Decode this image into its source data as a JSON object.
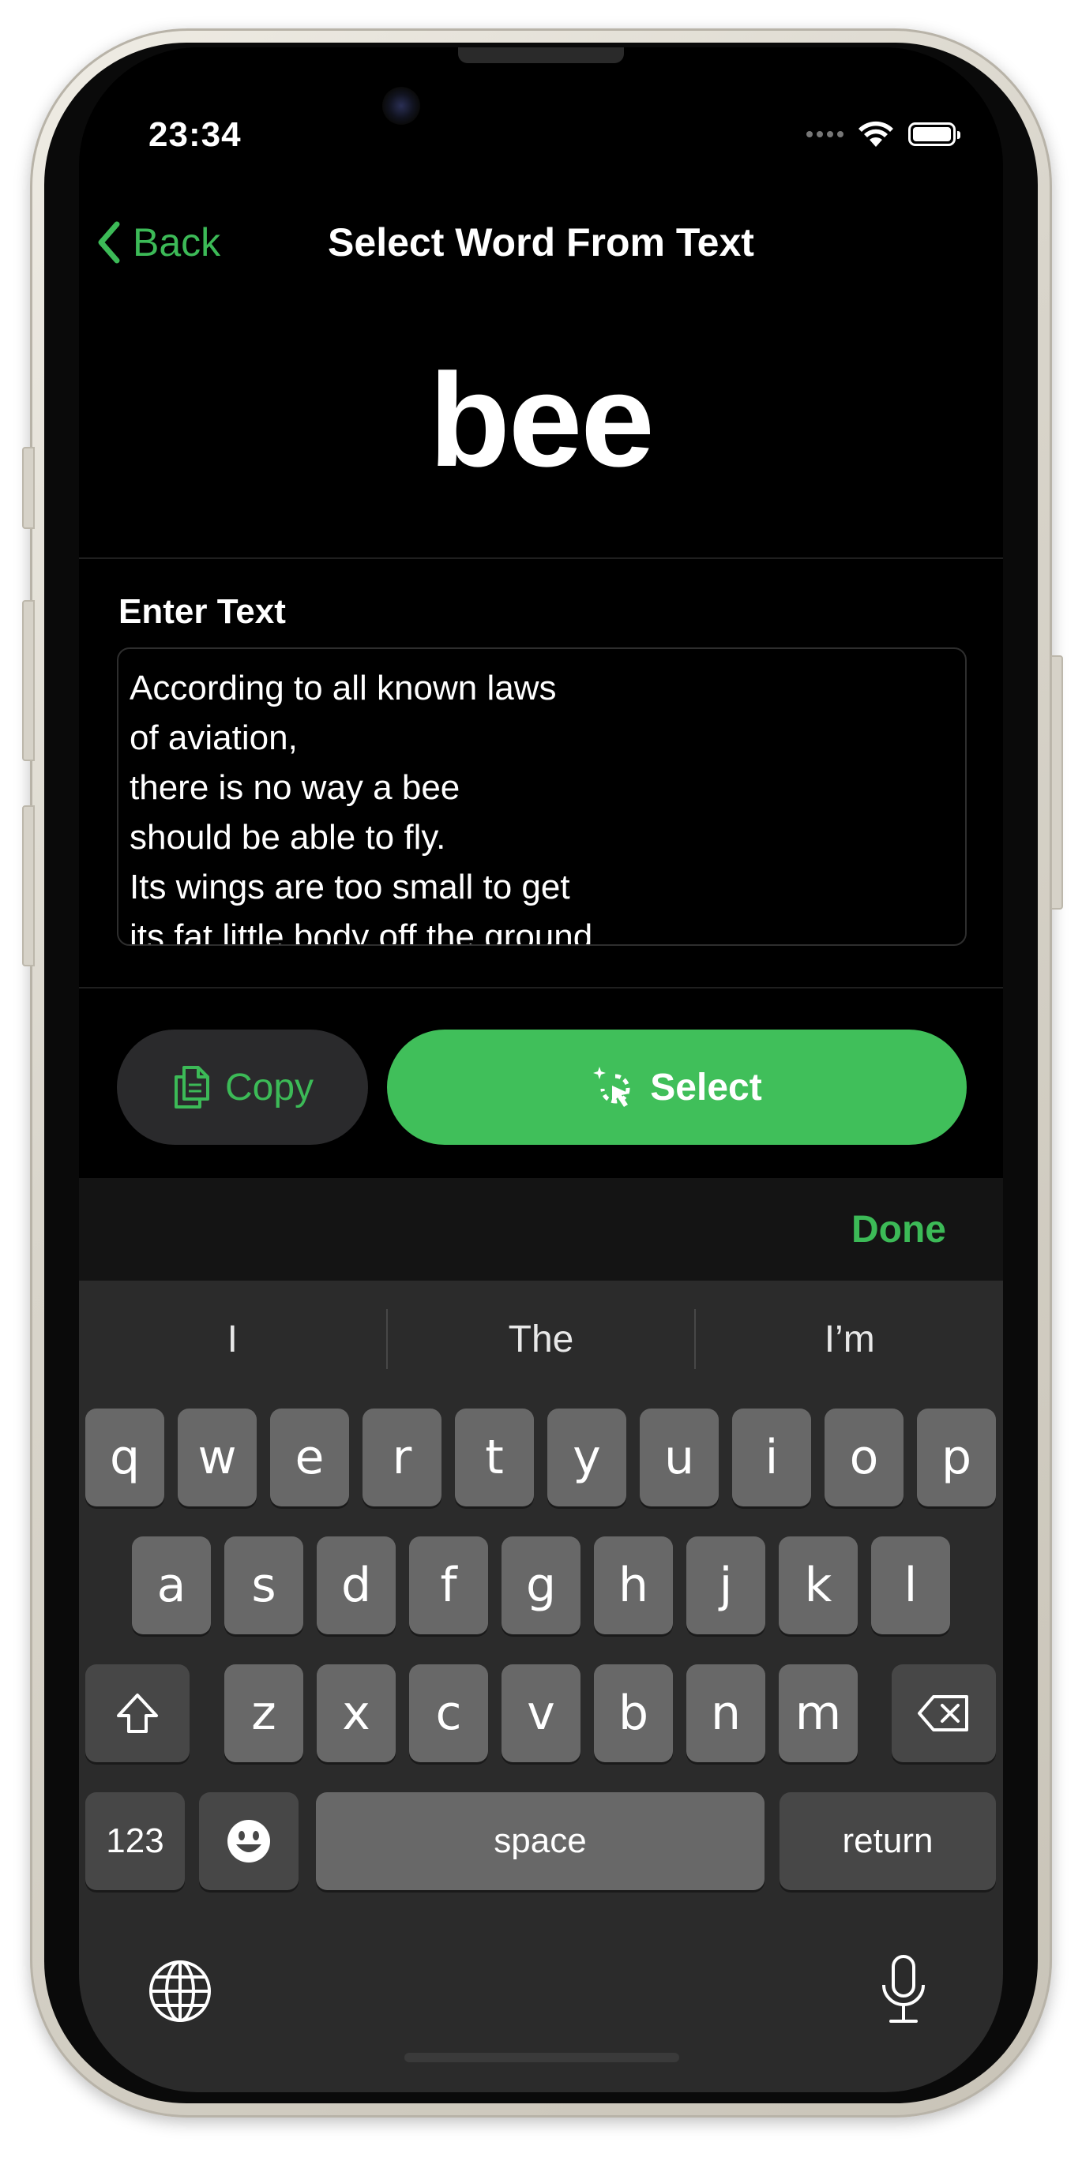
{
  "status_bar": {
    "time": "23:34"
  },
  "nav": {
    "back_label": "Back",
    "title": "Select Word From Text"
  },
  "selected_word": "bee",
  "input_section": {
    "label": "Enter Text",
    "lines": [
      "According to all known laws",
      "of aviation,",
      "there is no way a bee",
      "should be able to fly.",
      "Its wings are too small to get",
      "its fat little body off the ground."
    ]
  },
  "actions": {
    "copy_label": "Copy",
    "select_label": "Select"
  },
  "accessory": {
    "done_label": "Done"
  },
  "keyboard": {
    "suggestions": [
      "I",
      "The",
      "I’m"
    ],
    "row1": [
      "q",
      "w",
      "e",
      "r",
      "t",
      "y",
      "u",
      "i",
      "o",
      "p"
    ],
    "row2": [
      "a",
      "s",
      "d",
      "f",
      "g",
      "h",
      "j",
      "k",
      "l"
    ],
    "row3": [
      "z",
      "x",
      "c",
      "v",
      "b",
      "n",
      "m"
    ],
    "numbers_label": "123",
    "space_label": "space",
    "return_label": "return"
  },
  "colors": {
    "accent": "#40bf5a",
    "background": "#000000",
    "key": "#686868",
    "key_dark": "#474747"
  }
}
